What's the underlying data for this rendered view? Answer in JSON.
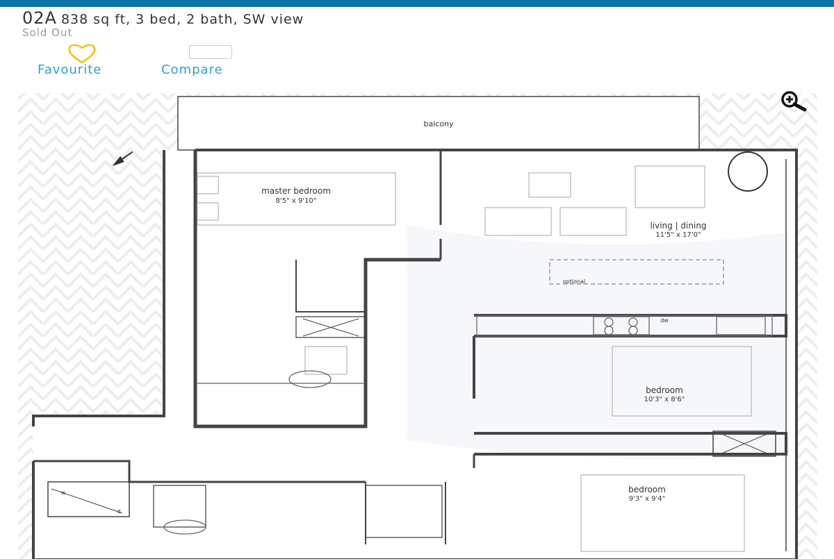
{
  "unit": {
    "code": "02A",
    "description": "838 sq ft, 3 bed, 2 bath, SW view",
    "status": "Sold Out"
  },
  "actions": {
    "favourite_label": "Favourite",
    "compare_label": "Compare"
  },
  "floorplan": {
    "north_marker": "N",
    "rooms": {
      "balcony": "balcony",
      "master_bedroom_name": "master bedroom",
      "master_bedroom_size": "8'5\" x 9'10\"",
      "living_name": "living | dining",
      "living_size": "11'5\" x 17'0\"",
      "optional": "optional",
      "dw": "dw",
      "bedroom2_name": "bedroom",
      "bedroom2_size": "10'3\" x 8'6\"",
      "bedroom3_name": "bedroom",
      "bedroom3_size": "9'3\" x 9'4\"",
      "laundry_w": "w",
      "laundry_d": "d"
    }
  },
  "colors": {
    "accent": "#2aa0d0",
    "topbar": "#0d74a8",
    "heart": "#f1c40f",
    "wall": "#444444"
  },
  "icons": {
    "favourite": "heart-icon",
    "compare": "checkbox-icon",
    "zoom": "zoom-in-icon",
    "north": "north-arrow-icon"
  }
}
